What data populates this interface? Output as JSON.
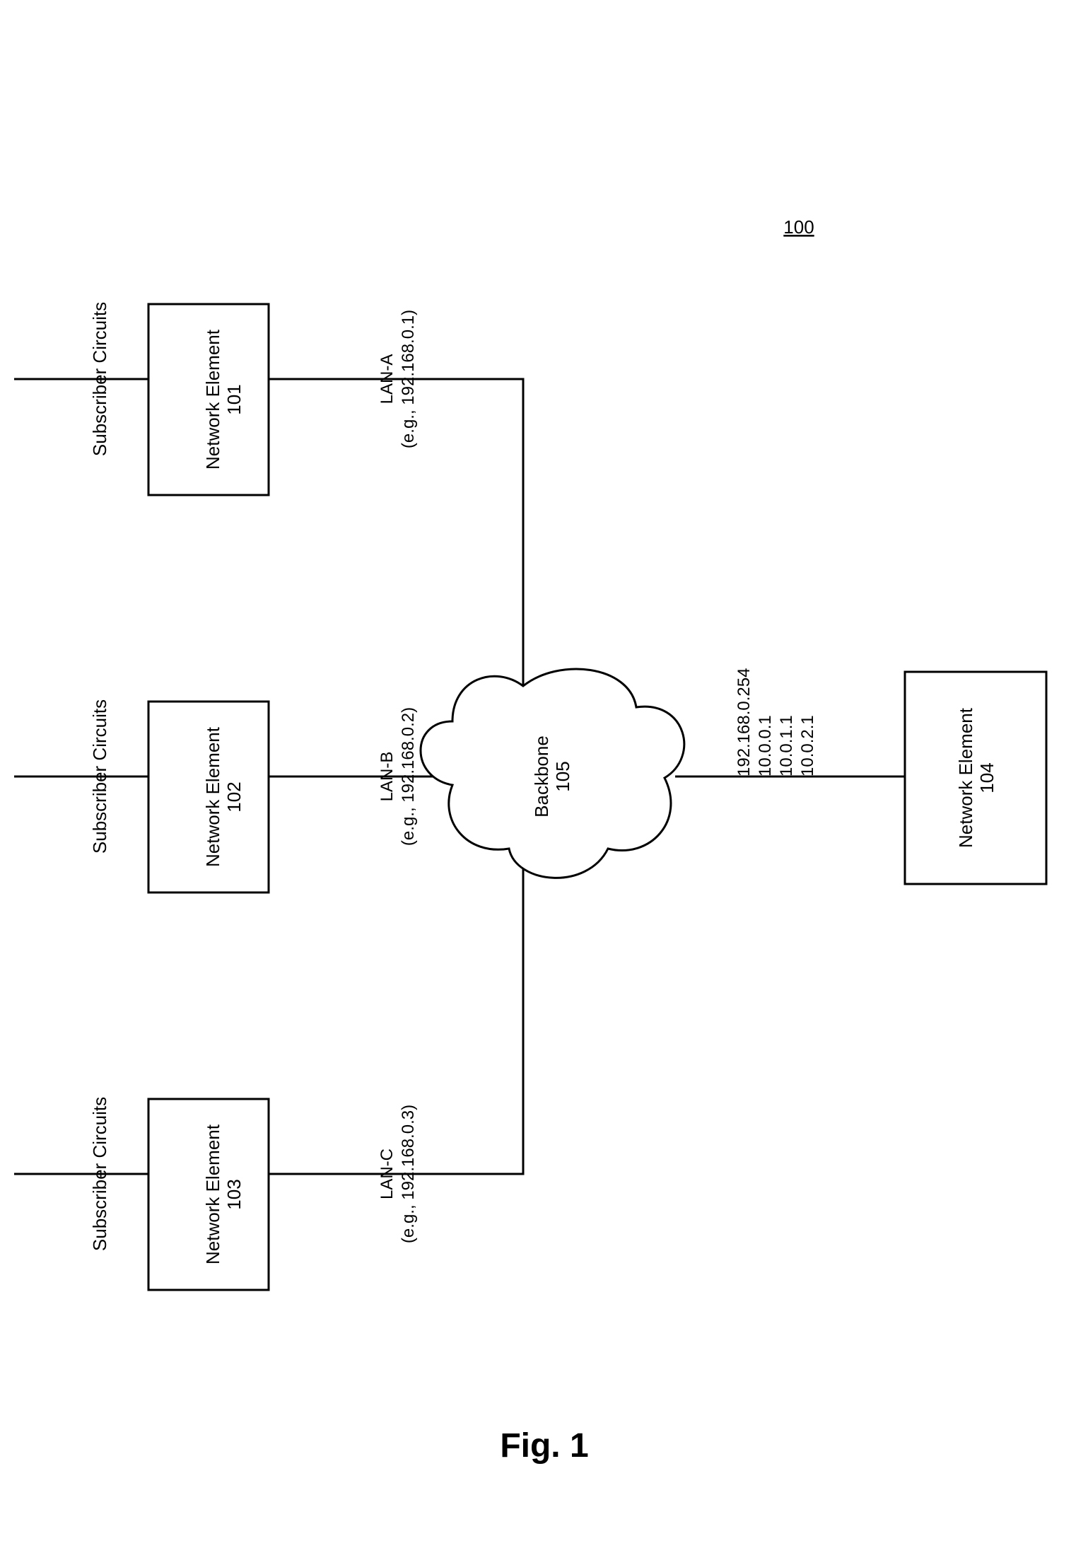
{
  "figureNumber": "100",
  "caption": "Fig. 1",
  "subscribers": {
    "label": "Subscriber Circuits"
  },
  "ne101": {
    "title": "Network Element",
    "id": "101"
  },
  "ne102": {
    "title": "Network Element",
    "id": "102"
  },
  "ne103": {
    "title": "Network Element",
    "id": "103"
  },
  "ne104": {
    "title": "Network Element",
    "id": "104"
  },
  "lanA": {
    "name": "LAN-A",
    "ip": "(e.g., 192.168.0.1)"
  },
  "lanB": {
    "name": "LAN-B",
    "ip": "(e.g., 192.168.0.2)"
  },
  "lanC": {
    "name": "LAN-C",
    "ip": "(e.g., 192.168.0.3)"
  },
  "backbone": {
    "title": "Backbone",
    "id": "105"
  },
  "rightIface": {
    "ip1": "192.168.0.254",
    "ip2": "10.0.0.1",
    "ip3": "10.0.1.1",
    "ip4": "10.0.2.1"
  }
}
